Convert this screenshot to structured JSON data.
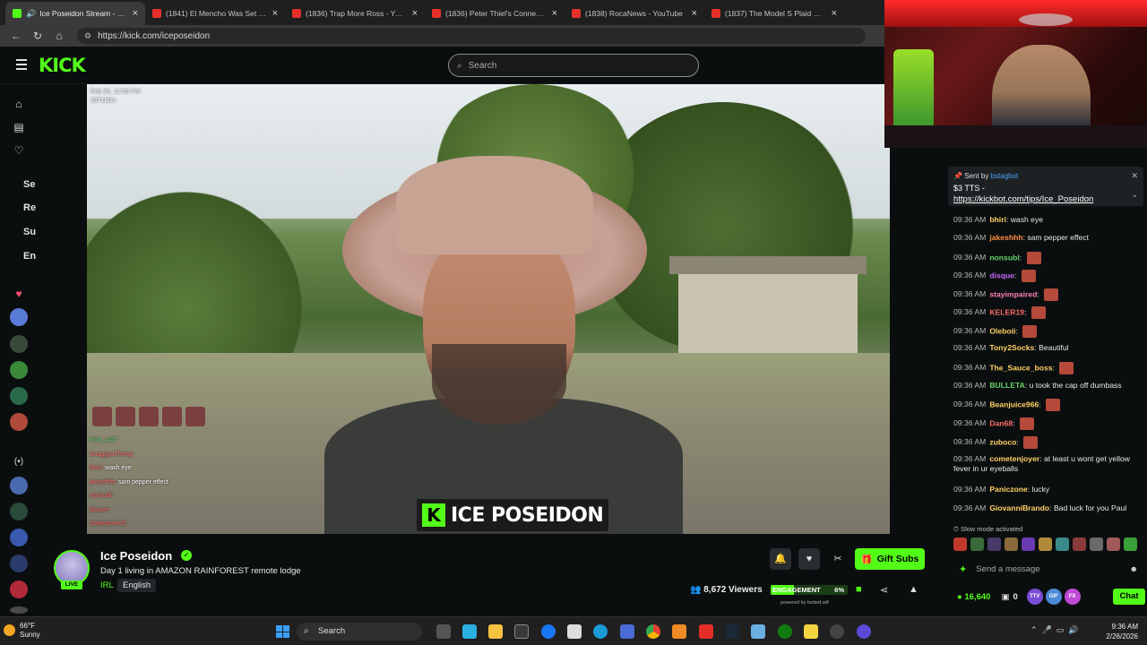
{
  "browser": {
    "tabs": [
      {
        "title": "Ice Poseidon Stream - Watch",
        "favicon": "kick-icon",
        "active": true
      },
      {
        "title": "(1841) El Mencho Was Set Up By",
        "favicon": "youtube-icon"
      },
      {
        "title": "(1836) Trap More Ross - YouTube",
        "favicon": "youtube-icon"
      },
      {
        "title": "(1836) Peter Thiel's Connections",
        "favicon": "youtube-icon"
      },
      {
        "title": "(1838) RocaNews - YouTube",
        "favicon": "youtube-icon"
      },
      {
        "title": "(1837) The Model S Plaid Walked",
        "favicon": "youtube-icon"
      }
    ],
    "url": "https://kick.com/iceposeidon"
  },
  "header": {
    "logo": "KICK",
    "search_placeholder": "Search"
  },
  "sidebar": {
    "nav_icons": [
      "home-icon",
      "browse-icon",
      "following-icon"
    ],
    "section_labels": [
      "Se",
      "Re",
      "Su",
      "En"
    ],
    "followed_avatars": 5,
    "recommended_avatars": 6
  },
  "video": {
    "timestamp": "Feb 26, 12:36 PM",
    "bitrate": "3871kb/s",
    "overlay_logo": "K",
    "overlay_name": "ICE POSEIDON",
    "chat_overlay": [
      {
        "user": "Kick_UAT:",
        "text": ""
      },
      {
        "user": "SnaggyaThong:",
        "text": ""
      },
      {
        "user": "bhiri:",
        "text": "wash eye"
      },
      {
        "user": "jakeshhh:",
        "text": "sam pepper effect"
      },
      {
        "user": "nonsubl:",
        "text": ""
      },
      {
        "user": "disque:",
        "text": ""
      },
      {
        "user": "stayimpaired:",
        "text": ""
      }
    ]
  },
  "stream": {
    "streamer": "Ice Poseidon",
    "title": "Day 1 living in AMAZON RAINFOREST remote lodge",
    "category": "IRL",
    "language": "English",
    "live_label": "LIVE",
    "viewers": "8,672 Viewers",
    "engagement_label": "ENGAGEMENT",
    "engagement_value": "6%",
    "engagement_fraction": 0.06,
    "gift_label": "Gift Subs",
    "powered_by": "powered by botted.wtf"
  },
  "chat": {
    "pinned": {
      "sent_by_label": "Sent by",
      "sender": "bstagbot",
      "amount": "$3 TTS -",
      "link": "https://kickbot.com/tips/Ice_Poseidon"
    },
    "messages": [
      {
        "time": "09:36 AM",
        "user": "bhiri",
        "text": "wash eye",
        "color": "#ffd166"
      },
      {
        "time": "09:36 AM",
        "user": "jakeshhh",
        "text": "sam pepper effect",
        "color": "#ff8c42"
      },
      {
        "time": "09:36 AM",
        "user": "nonsubl",
        "text": "",
        "color": "#66d36a",
        "emote": true
      },
      {
        "time": "09:36 AM",
        "user": "disque",
        "text": "",
        "color": "#c86bff",
        "emote": true
      },
      {
        "time": "09:36 AM",
        "user": "stayimpaired",
        "text": "",
        "color": "#ff7eb6",
        "emote": true
      },
      {
        "time": "09:36 AM",
        "user": "KELER19",
        "text": "",
        "color": "#ff6b6b",
        "emote": true
      },
      {
        "time": "09:36 AM",
        "user": "Oleboii",
        "text": "",
        "color": "#ffd166",
        "emote": true
      },
      {
        "time": "09:36 AM",
        "user": "Tony2Socks",
        "text": "Beautiful",
        "color": "#ffd166"
      },
      {
        "time": "09:36 AM",
        "user": "The_Sauce_boss",
        "text": "",
        "color": "#ffd166",
        "emote": true
      },
      {
        "time": "09:36 AM",
        "user": "BULLETA",
        "text": "u took the cap off dumbass",
        "color": "#66d36a"
      },
      {
        "time": "09:36 AM",
        "user": "Beanjuice966",
        "text": "",
        "color": "#ffd166",
        "emote": true
      },
      {
        "time": "09:36 AM",
        "user": "Dan68",
        "text": "",
        "color": "#ff6b6b",
        "emote": true
      },
      {
        "time": "09:36 AM",
        "user": "zuboco",
        "text": "",
        "color": "#ffd166",
        "emote": true
      },
      {
        "time": "09:36 AM",
        "user": "cometenjoyer",
        "text": "at least u wont get yellow fever in ur eyeballs",
        "color": "#ffd166"
      },
      {
        "time": "09:36 AM",
        "user": "Paniczone",
        "text": "lucky",
        "color": "#ffd166"
      },
      {
        "time": "09:36 AM",
        "user": "GiovanniBrando",
        "text": "Bad luck for you Paul",
        "color": "#ffd166"
      }
    ],
    "slow_mode": "Slow mode activated",
    "send_placeholder": "Send a message",
    "points": "16,640",
    "gift_count": "0",
    "chat_button": "Chat",
    "pills": [
      "TTV",
      "GIF",
      "FX"
    ]
  },
  "taskbar": {
    "weather_temp": "66°F",
    "weather_text": "Sunny",
    "search_label": "Search",
    "time": "9:36 AM",
    "date": "2/26/2026"
  }
}
